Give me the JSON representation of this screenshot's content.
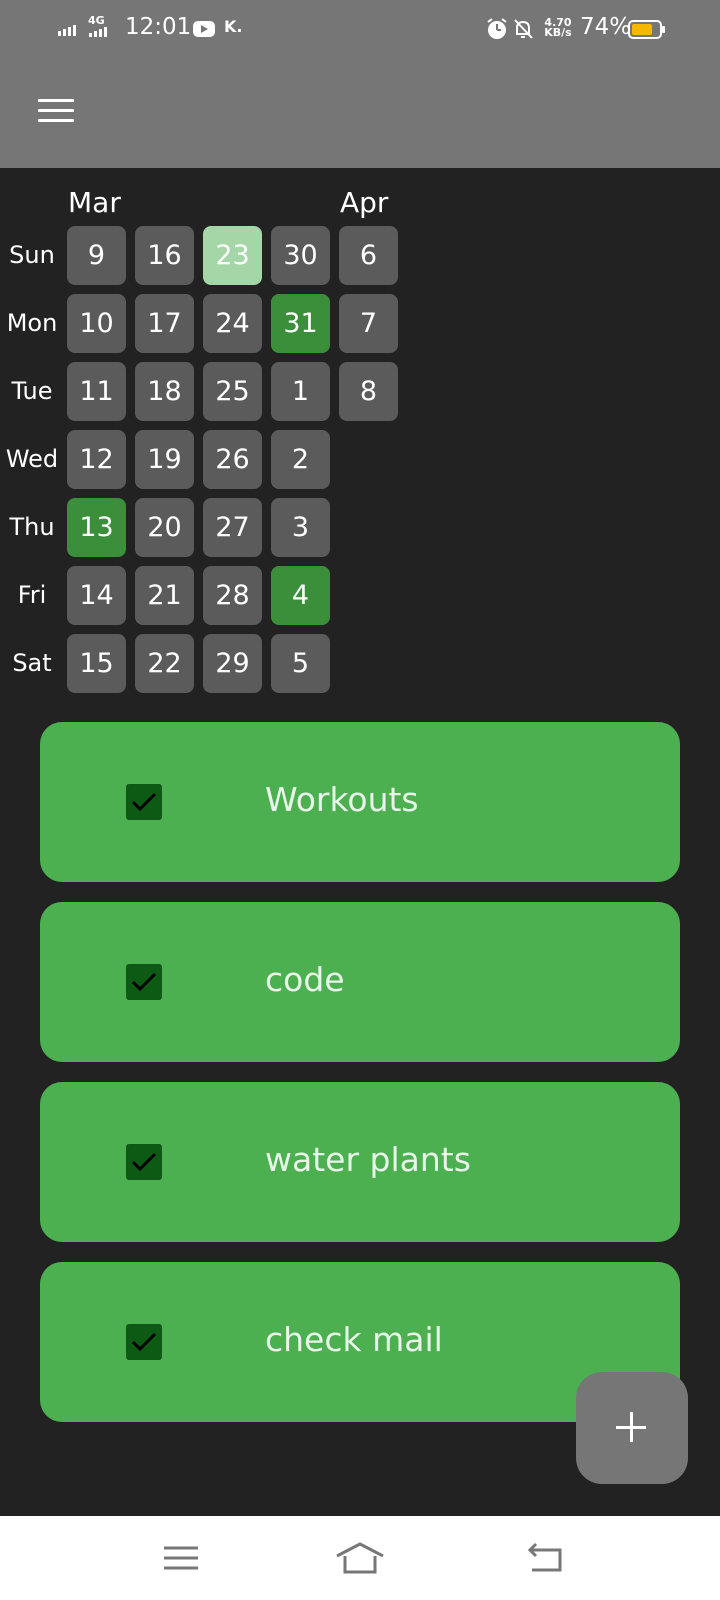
{
  "status_bar": {
    "network_type": "4G",
    "time": "12:01",
    "carrier_badge": "K.",
    "speed_value": "4.70",
    "speed_unit": "KB/s",
    "battery": "74%",
    "icons": [
      "signal-icon",
      "mobile-data-icon",
      "youtube-icon",
      "carrier-icon",
      "alarm-icon",
      "notifications-off-icon",
      "battery-icon"
    ]
  },
  "app_bar": {
    "menu_icon": "hamburger-menu-icon"
  },
  "calendar": {
    "months": [
      "Mar",
      "Apr"
    ],
    "weekdays": [
      "Sun",
      "Mon",
      "Tue",
      "Wed",
      "Thu",
      "Fri",
      "Sat"
    ],
    "weeks": [
      [
        "9",
        "10",
        "11",
        "12",
        "13",
        "14",
        "15"
      ],
      [
        "16",
        "17",
        "18",
        "19",
        "20",
        "21",
        "22"
      ],
      [
        "23",
        "24",
        "25",
        "26",
        "27",
        "28",
        "29"
      ],
      [
        "30",
        "31",
        "1",
        "2",
        "3",
        "4",
        "5"
      ],
      [
        "6",
        "7",
        "8"
      ]
    ],
    "completed_days": [
      "13",
      "31",
      "4"
    ],
    "highlighted_day": "23",
    "colors": {
      "cell": "#5b5b5b",
      "completed": "#3b8f3b",
      "highlight": "#a5d6a7"
    }
  },
  "habits": [
    {
      "name": "Workouts",
      "checked": true
    },
    {
      "name": "code",
      "checked": true
    },
    {
      "name": "water plants",
      "checked": true
    },
    {
      "name": "check mail",
      "checked": true
    }
  ],
  "fab": {
    "icon": "plus-icon"
  },
  "nav_bar": {
    "icons": [
      "recents-icon",
      "home-icon",
      "back-icon"
    ]
  },
  "colors": {
    "background": "#222222",
    "bar": "#767676",
    "card": "#4caf50",
    "checkbox": "#0d5a14"
  }
}
